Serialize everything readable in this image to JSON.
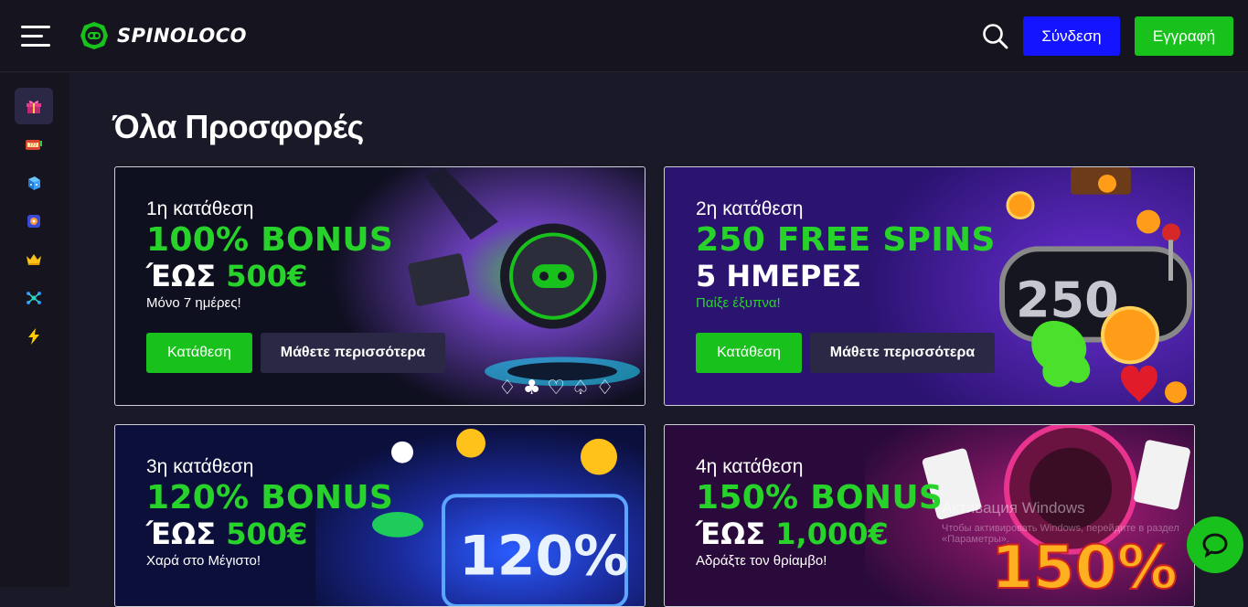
{
  "header": {
    "logo_text": "SPINOLOCO",
    "login_label": "Σύνδεση",
    "register_label": "Εγγραφή",
    "icons": [
      "hamburger-menu-icon",
      "logo-icon",
      "search-icon"
    ]
  },
  "sidebar": {
    "items": [
      {
        "name": "gift-icon",
        "active": true
      },
      {
        "name": "slot-machine-icon",
        "active": false
      },
      {
        "name": "dice-icon",
        "active": false
      },
      {
        "name": "live-casino-icon",
        "active": false
      },
      {
        "name": "crown-icon",
        "active": false
      },
      {
        "name": "tournament-icon",
        "active": false
      },
      {
        "name": "lightning-icon",
        "active": false
      }
    ]
  },
  "main": {
    "title": "Όλα Προσφορές",
    "cards": [
      {
        "deposit": "1η κατάθεση",
        "headline": "100% BONUS",
        "upto_prefix": "ΈΩΣ",
        "upto_amount": "500€",
        "tagline": "Μόνο 7 ημέρες!",
        "deposit_button": "Κατάθεση",
        "more_button": "Μάθετε περισσότερα"
      },
      {
        "deposit": "2η κατάθεση",
        "headline": "250 FREE SPINS",
        "upto_prefix": "5 ΗΜΕΡΕΣ",
        "upto_amount": "",
        "tagline": "Παίξε έξυπνα!",
        "deposit_button": "Κατάθεση",
        "more_button": "Μάθετε περισσότερα",
        "art_text": "250"
      },
      {
        "deposit": "3η κατάθεση",
        "headline": "120% BONUS",
        "upto_prefix": "ΈΩΣ",
        "upto_amount": "500€",
        "tagline": "Χαρά στο Μέγιστο!",
        "art_text": "120%"
      },
      {
        "deposit": "4η κατάθεση",
        "headline": "150% BONUS",
        "upto_prefix": "ΈΩΣ",
        "upto_amount": "1,000€",
        "tagline": "Αδράξτε τον θρίαμβο!",
        "art_text": "150%"
      }
    ]
  },
  "overlay": {
    "watermark_title": "Активация Windows",
    "watermark_sub": "Чтобы активировать Windows, перейдите в раздел «Параметры»."
  },
  "colors": {
    "accent_green": "#19c11c",
    "headline_green": "#27d32a",
    "login_blue": "#1414ff",
    "background": "#1a1928"
  }
}
